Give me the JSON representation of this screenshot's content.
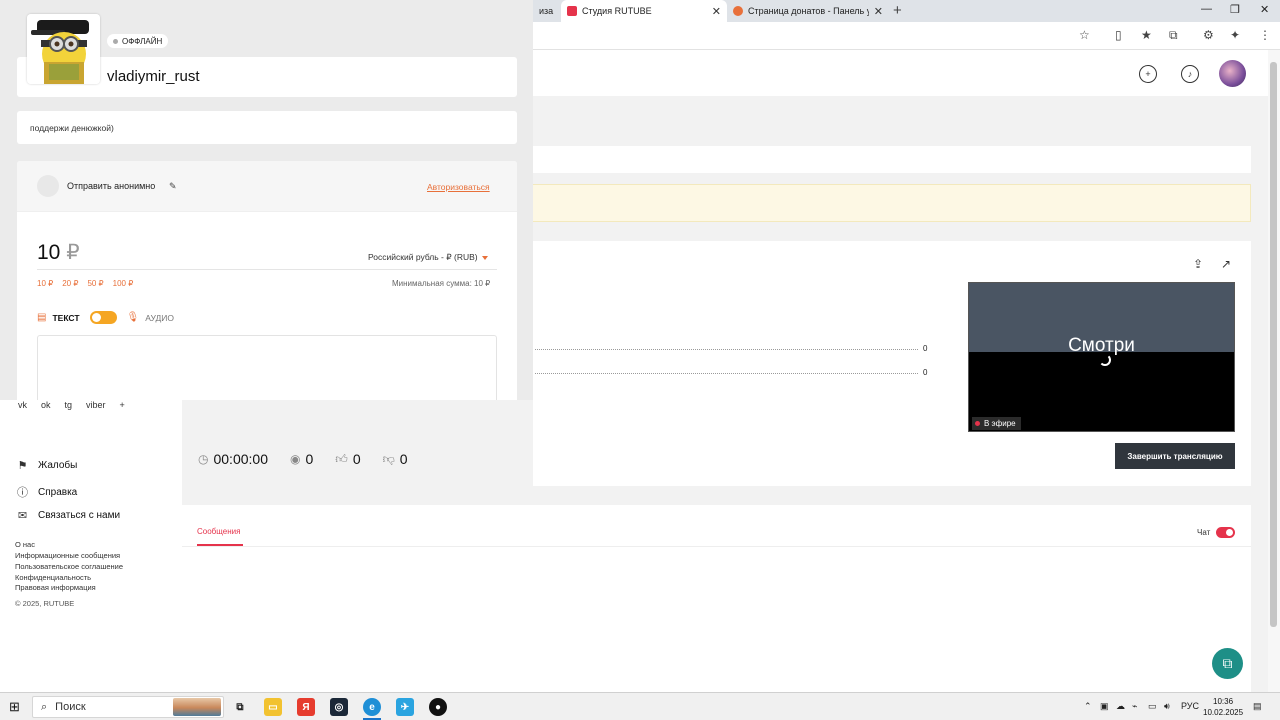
{
  "browser": {
    "tabs": [
      {
        "label": "иза",
        "icon": "tab-partial"
      },
      {
        "label": "Студия RUTUBE",
        "icon": "rutube-icon",
        "color": "#e5334b"
      },
      {
        "label": "Страница донатов - Панель упр",
        "icon": "donate-icon",
        "color": "#e8703a"
      }
    ],
    "new_tab": "+"
  },
  "donation": {
    "status": "ОФФЛАЙН",
    "username": "vladiymir_rust",
    "description": "поддержи денюжкой)",
    "send_anon": "Отправить анонимно",
    "auth_link": "Авторизоваться",
    "amount": "10",
    "currency_symbol": "₽",
    "currency_select": "Российский рубль - ₽ (RUB)",
    "presets": [
      "10 ₽",
      "20 ₽",
      "50 ₽",
      "100 ₽"
    ],
    "min_sum": "Минимальная сумма: 10 ₽",
    "mode_text": "ТЕКСТ",
    "mode_audio": "АУДИО"
  },
  "stream": {
    "meter_values": [
      "0",
      "0"
    ],
    "preview_text": "Смотри",
    "live_label": "В эфире",
    "timer": "00:00:00",
    "viewers": "0",
    "likes": "0",
    "dislikes": "0",
    "end_button": "Завершить трансляцию"
  },
  "leftnav": {
    "social": [
      "vk",
      "ok",
      "tg",
      "viber",
      "+"
    ],
    "items": [
      {
        "label": "Жалобы",
        "icon": "flag-icon"
      },
      {
        "label": "Справка",
        "icon": "help-icon"
      },
      {
        "label": "Связаться с нами",
        "icon": "mail-icon"
      }
    ],
    "footer": [
      "О нас",
      "Информационные сообщения",
      "Пользовательское соглашение",
      "Конфиденциальность",
      "Правовая информация",
      "© 2025, RUTUBE"
    ]
  },
  "chat": {
    "tab": "Сообщения",
    "toggle_label": "Чат"
  },
  "taskbar": {
    "search": "Поиск",
    "lang": "РУС",
    "time": "10:36",
    "date": "10.02.2025"
  }
}
